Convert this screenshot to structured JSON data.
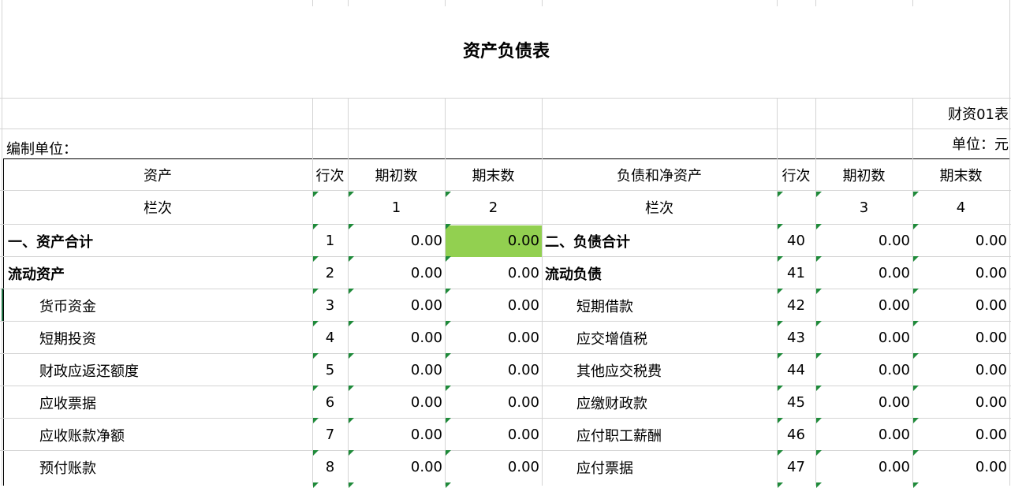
{
  "sheet": {
    "title": "资产负债表",
    "form_no": "财资01表",
    "unit_label": "单位：元",
    "org_label": "编制单位："
  },
  "header": {
    "assets": "资产",
    "row_no": "行次",
    "begin": "期初数",
    "end": "期末数",
    "liabilities": "负债和净资产",
    "row_no2": "行次",
    "begin2": "期初数",
    "end2": "期末数"
  },
  "column_index": {
    "left_label": "栏次",
    "c1": "1",
    "c2": "2",
    "right_label": "栏次",
    "c3": "3",
    "c4": "4"
  },
  "rows": [
    {
      "asset": "一、资产合计",
      "asset_bold": true,
      "line": "1",
      "begin": "0.00",
      "end": "0.00",
      "liab": "二、负债合计",
      "liab_bold": true,
      "line2": "40",
      "begin2": "0.00",
      "end2": "0.00"
    },
    {
      "asset": "流动资产",
      "asset_bold": true,
      "line": "2",
      "begin": "0.00",
      "end": "0.00",
      "liab": "流动负债",
      "liab_bold": true,
      "line2": "41",
      "begin2": "0.00",
      "end2": "0.00"
    },
    {
      "asset": "货币资金",
      "asset_bold": false,
      "line": "3",
      "begin": "0.00",
      "end": "0.00",
      "liab": "短期借款",
      "liab_bold": false,
      "line2": "42",
      "begin2": "0.00",
      "end2": "0.00"
    },
    {
      "asset": "短期投资",
      "asset_bold": false,
      "line": "4",
      "begin": "0.00",
      "end": "0.00",
      "liab": "应交增值税",
      "liab_bold": false,
      "line2": "43",
      "begin2": "0.00",
      "end2": "0.00"
    },
    {
      "asset": "财政应返还额度",
      "asset_bold": false,
      "line": "5",
      "begin": "0.00",
      "end": "0.00",
      "liab": "其他应交税费",
      "liab_bold": false,
      "line2": "44",
      "begin2": "0.00",
      "end2": "0.00"
    },
    {
      "asset": "应收票据",
      "asset_bold": false,
      "line": "6",
      "begin": "0.00",
      "end": "0.00",
      "liab": "应缴财政款",
      "liab_bold": false,
      "line2": "45",
      "begin2": "0.00",
      "end2": "0.00"
    },
    {
      "asset": "应收账款净额",
      "asset_bold": false,
      "line": "7",
      "begin": "0.00",
      "end": "0.00",
      "liab": "应付职工薪酬",
      "liab_bold": false,
      "line2": "46",
      "begin2": "0.00",
      "end2": "0.00"
    },
    {
      "asset": "预付账款",
      "asset_bold": false,
      "line": "8",
      "begin": "0.00",
      "end": "0.00",
      "liab": "应付票据",
      "liab_bold": false,
      "line2": "47",
      "begin2": "0.00",
      "end2": "0.00"
    }
  ],
  "colors": {
    "highlight_cell": "#92d050",
    "comment_indicator": "#1f8a3a",
    "gridline": "#d4d4d4"
  }
}
